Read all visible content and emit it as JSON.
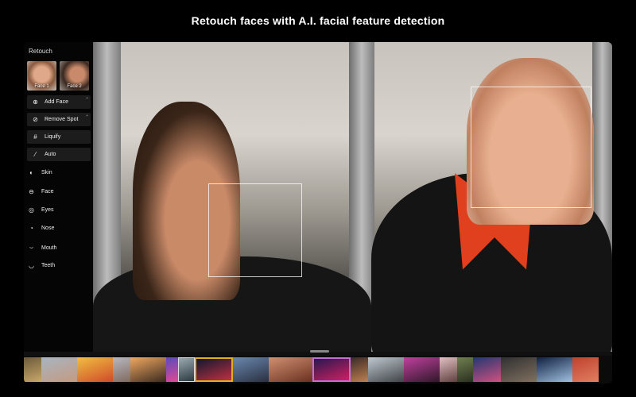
{
  "title": "Retouch faces with A.I. facial feature detection",
  "sidebar": {
    "heading": "Retouch",
    "faces": [
      {
        "label": "Face 1"
      },
      {
        "label": "Face 2"
      }
    ],
    "buttons": [
      {
        "label": "Add Face",
        "icon": "add-circle-icon",
        "plus": "+"
      },
      {
        "label": "Remove Spot",
        "icon": "bandage-icon",
        "plus": "+"
      },
      {
        "label": "Liquify",
        "icon": "grid-icon"
      },
      {
        "label": "Auto",
        "icon": "magic-wand-icon"
      }
    ],
    "items": [
      {
        "label": "Skin",
        "icon": "half-circle-icon"
      },
      {
        "label": "Face",
        "icon": "face-outline-icon"
      },
      {
        "label": "Eyes",
        "icon": "eye-icon"
      },
      {
        "label": "Nose",
        "icon": "nose-icon"
      },
      {
        "label": "Mouth",
        "icon": "mouth-icon"
      },
      {
        "label": "Teeth",
        "icon": "teeth-icon"
      }
    ]
  },
  "filmstrip": {
    "thumbs": [
      {
        "c1": "#6b5a3a",
        "c2": "#c9a86a",
        "w": 22
      },
      {
        "c1": "#a8b5c2",
        "c2": "#c49a80",
        "w": 45
      },
      {
        "c1": "#f0c040",
        "c2": "#d04a2a",
        "w": 45
      },
      {
        "c1": "#b8b8c0",
        "c2": "#806a60",
        "w": 22
      },
      {
        "c1": "#f0a860",
        "c2": "#3a2a20",
        "w": 45
      },
      {
        "c1": "#5a4ac0",
        "c2": "#e04a90",
        "w": 15
      },
      {
        "c1": "#9aaab0",
        "c2": "#2a3a40",
        "w": 21,
        "selected": true
      },
      {
        "c1": "#101830",
        "c2": "#c03040",
        "w": 48,
        "framed": "#e0b020"
      },
      {
        "c1": "#6a88b0",
        "c2": "#2a3040",
        "w": 45
      },
      {
        "c1": "#d09070",
        "c2": "#6a3020",
        "w": 55
      },
      {
        "c1": "#281850",
        "c2": "#d02060",
        "w": 48,
        "framed": "#c070d0"
      },
      {
        "c1": "#3a2a28",
        "c2": "#c08050",
        "w": 22
      },
      {
        "c1": "#c0c8d0",
        "c2": "#404448",
        "w": 45
      },
      {
        "c1": "#c040a0",
        "c2": "#301828",
        "w": 45
      },
      {
        "c1": "#e0c0c0",
        "c2": "#604040",
        "w": 22
      },
      {
        "c1": "#708050",
        "c2": "#2a3020",
        "w": 20
      },
      {
        "c1": "#203870",
        "c2": "#d05080",
        "w": 35
      },
      {
        "c1": "#303030",
        "c2": "#807060",
        "w": 45
      },
      {
        "c1": "#102040",
        "c2": "#a0c0e0",
        "w": 45
      },
      {
        "c1": "#c04030",
        "c2": "#e08060",
        "w": 33
      }
    ]
  }
}
